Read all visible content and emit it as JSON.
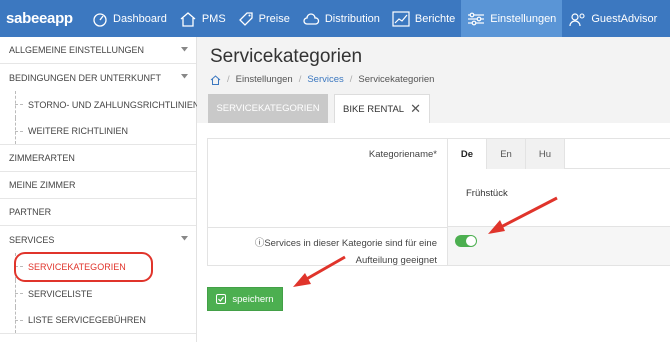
{
  "brand": "sabeeapp",
  "nav": [
    {
      "label": "Dashboard",
      "icon": "speedometer-icon"
    },
    {
      "label": "PMS",
      "icon": "house-icon"
    },
    {
      "label": "Preise",
      "icon": "tag-icon"
    },
    {
      "label": "Distribution",
      "icon": "cloud-icon"
    },
    {
      "label": "Berichte",
      "icon": "chart-icon"
    },
    {
      "label": "Einstellungen",
      "icon": "sliders-icon",
      "active": true
    },
    {
      "label": "GuestAdvisor",
      "icon": "guest-icon"
    }
  ],
  "sidebar": {
    "items": [
      {
        "label": "Allgemeine Einstellungen"
      },
      {
        "label": "Bedingungen der Unterkunft"
      },
      {
        "label": "Storno- und Zahlungsrichtlinien"
      },
      {
        "label": "Weitere Richtlinien"
      },
      {
        "label": "Zimmerarten"
      },
      {
        "label": "Meine Zimmer"
      },
      {
        "label": "Partner"
      },
      {
        "label": "Services"
      },
      {
        "label": "Servicekategorien"
      },
      {
        "label": "Serviceliste"
      },
      {
        "label": "Liste Servicegebühren"
      }
    ]
  },
  "page": {
    "title": "Servicekategorien",
    "breadcrumb": [
      "Einstellungen",
      "Services",
      "Servicekategorien"
    ]
  },
  "tabs": {
    "tab1": "Servicekategorien",
    "tab2": "Bike Rental"
  },
  "form": {
    "name_label": "Kategoriename*",
    "languages": [
      "De",
      "En",
      "Hu"
    ],
    "name_value": "Frühstück",
    "split_label_line1": "ⓘServices in dieser Kategorie sind für eine",
    "split_label_line2": "Aufteilung geeignet",
    "split_enabled": true
  },
  "save_label": "speichern",
  "colors": {
    "nav_bg": "#3c78c0",
    "nav_active": "#5a95d6",
    "accent_red": "#e0342b",
    "green": "#4caf50"
  }
}
